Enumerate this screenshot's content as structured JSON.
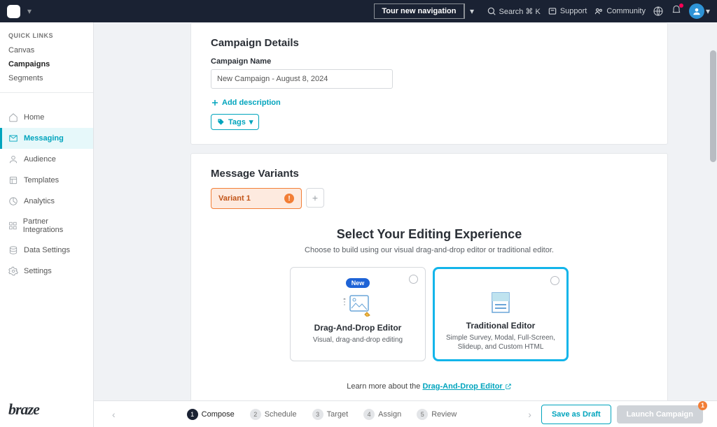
{
  "header": {
    "tour_btn": "Tour new navigation",
    "search": "Search ⌘ K",
    "support": "Support",
    "community": "Community"
  },
  "sidebar": {
    "quick_title": "QUICK LINKS",
    "quick": [
      "Canvas",
      "Campaigns",
      "Segments"
    ],
    "nav": [
      "Home",
      "Messaging",
      "Audience",
      "Templates",
      "Analytics",
      "Partner Integrations",
      "Data Settings",
      "Settings"
    ],
    "brand": "braze"
  },
  "details": {
    "section": "Campaign Details",
    "name_label": "Campaign Name",
    "name_value": "New Campaign - August 8, 2024",
    "add_desc": "Add description",
    "tags": "Tags"
  },
  "variants": {
    "section": "Message Variants",
    "tab": "Variant 1",
    "editing_title": "Select Your Editing Experience",
    "editing_sub": "Choose to build using our visual drag-and-drop editor or traditional editor.",
    "badge": "New",
    "editors": [
      {
        "title": "Drag-And-Drop Editor",
        "desc": "Visual, drag-and-drop editing"
      },
      {
        "title": "Traditional Editor",
        "desc": "Simple Survey, Modal, Full-Screen, Slideup, and Custom HTML"
      }
    ],
    "learn_prefix": "Learn more about the ",
    "learn_link": "Drag-And-Drop Editor"
  },
  "stepper": {
    "steps": [
      "Compose",
      "Schedule",
      "Target",
      "Assign",
      "Review"
    ],
    "draft": "Save as Draft",
    "launch": "Launch Campaign",
    "launch_badge": "1"
  }
}
